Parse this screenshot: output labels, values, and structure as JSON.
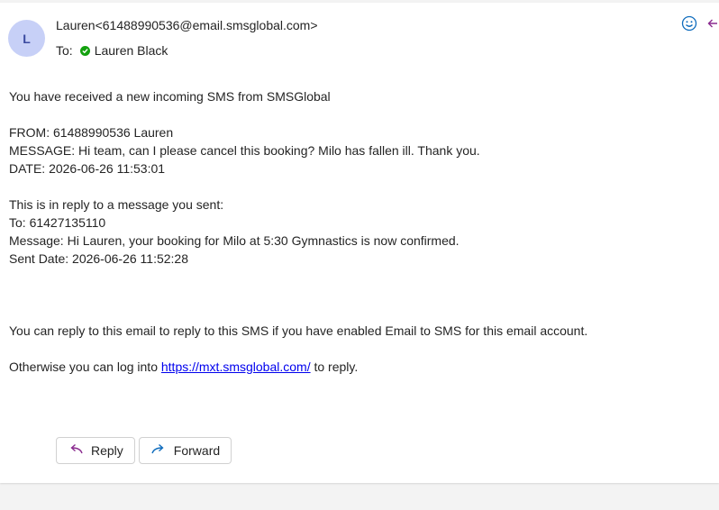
{
  "sender": {
    "initial": "L",
    "from_display": "Lauren<61488990536@email.smsglobal.com>"
  },
  "recipient": {
    "to_label": "To:",
    "name": "Lauren Black"
  },
  "body": {
    "intro": "You have received a new incoming SMS from SMSGlobal",
    "from": "FROM: 61488990536 Lauren",
    "message": "MESSAGE: Hi team, can I please cancel this booking? Milo has fallen ill. Thank you.",
    "date": "DATE: 2026-06-26 11:53:01",
    "reply_intro": "This is in reply to a message you sent:",
    "reply_to": "To: 61427135110",
    "reply_message": "Message: Hi Lauren, your booking for Milo at 5:30 Gymnastics is now confirmed.",
    "reply_sent_date": "Sent Date: 2026-06-26 11:52:28",
    "reply_info": "You can reply to this email to reply to this SMS if you have enabled Email to SMS for this email account.",
    "otherwise_prefix": "Otherwise you can log into ",
    "link_text": "https://mxt.smsglobal.com/",
    "otherwise_suffix": " to reply."
  },
  "actions": {
    "reply_label": "Reply",
    "forward_label": "Forward"
  },
  "icons": {
    "emoji": "smiley-icon",
    "reply_top": "reply-arrow-icon"
  },
  "colors": {
    "avatar_bg": "#c7d0f7",
    "verified": "#13a10e",
    "link": "#0000ee",
    "reply_icon": "#8a2b8f",
    "forward_icon": "#0f6cbd"
  }
}
